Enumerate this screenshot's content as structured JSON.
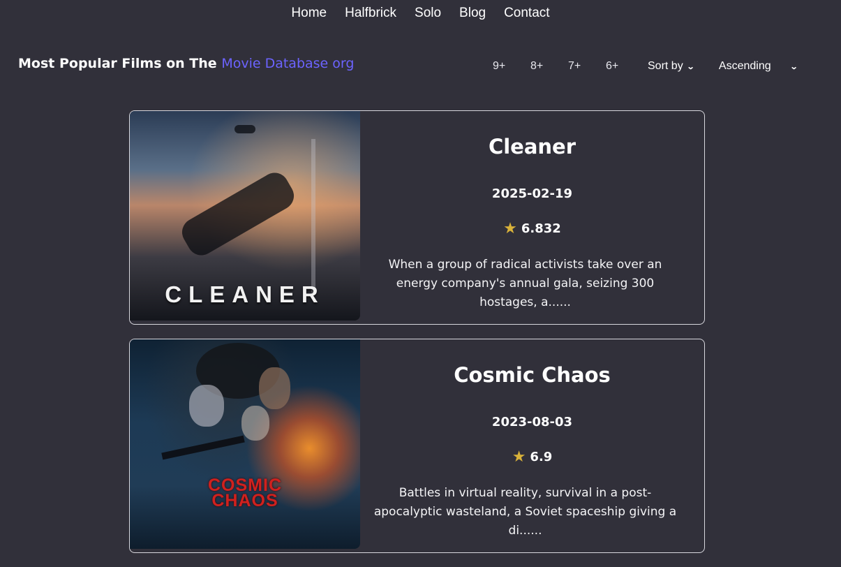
{
  "nav": {
    "items": [
      {
        "label": "Home"
      },
      {
        "label": "Halfbrick"
      },
      {
        "label": "Solo"
      },
      {
        "label": "Blog"
      },
      {
        "label": "Contact"
      }
    ]
  },
  "header": {
    "title_prefix": "Most Popular Films on The ",
    "title_accent": "Movie Database org"
  },
  "filters": {
    "ratings": [
      "9+",
      "8+",
      "7+",
      "6+"
    ],
    "sort_by_label": "Sort by",
    "order_label": "Ascending"
  },
  "films": [
    {
      "title": "Cleaner",
      "poster_title": "CLEANER",
      "date": "2025-02-19",
      "rating": "6.832",
      "overview": "When a group of radical activists take over an energy company's annual gala, seizing 300 hostages, a......"
    },
    {
      "title": "Cosmic Chaos",
      "poster_title_line1": "COSMIC",
      "poster_title_line2": "CHAOS",
      "date": "2023-08-03",
      "rating": "6.9",
      "overview": "Battles in virtual reality, survival in a post-apocalyptic wasteland, a Soviet spaceship giving a di......"
    }
  ],
  "colors": {
    "background": "#31303a",
    "accent": "#6c63ff",
    "star": "#d9b23a",
    "card_border": "#d8d8de"
  },
  "icons": {
    "rating": "star-icon",
    "dropdown": "chevron-down-icon"
  }
}
